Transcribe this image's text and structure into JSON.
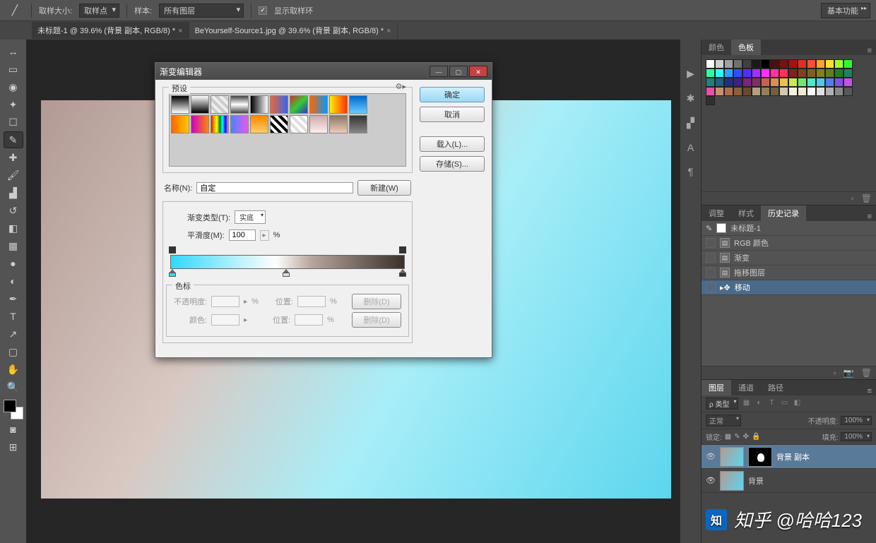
{
  "options": {
    "sample_size_label": "取样大小:",
    "sample_size_value": "取样点",
    "sample_label": "样本:",
    "sample_value": "所有图层",
    "show_ring_label": "显示取样环",
    "workspace": "基本功能"
  },
  "tabs": [
    {
      "label": "未标题-1 @ 39.6% (背景 副本, RGB/8) *",
      "active": true
    },
    {
      "label": "BeYourself-Source1.jpg @ 39.6% (背景 副本, RGB/8) *",
      "active": false
    }
  ],
  "panels": {
    "color_tabs": [
      "颜色",
      "色板"
    ],
    "color_active_idx": 1,
    "history_tabs": [
      "调整",
      "样式",
      "历史记录"
    ],
    "history_active_idx": 2,
    "history_doc": "未标题-1",
    "history": [
      {
        "label": "RGB 颜色"
      },
      {
        "label": "渐变"
      },
      {
        "label": "拖移图层"
      },
      {
        "label": "移动"
      }
    ],
    "layers_tabs": [
      "图层",
      "通道",
      "路径"
    ],
    "layers_active_idx": 0,
    "layer_kind": "ρ 类型",
    "blend_mode": "正常",
    "opacity_label": "不透明度:",
    "opacity_value": "100%",
    "lock_label": "锁定:",
    "fill_label": "填充:",
    "fill_value": "100%",
    "layer1": "背景 副本",
    "layer2": "背景"
  },
  "dialog": {
    "title": "渐变编辑器",
    "presets_label": "预设",
    "ok": "确定",
    "cancel": "取消",
    "load": "载入(L)...",
    "save": "存储(S)...",
    "name_label": "名称(N):",
    "name_value": "自定",
    "new_btn": "新建(W)",
    "gradient_type_label": "渐变类型(T):",
    "gradient_type_value": "实底",
    "smoothness_label": "平滑度(M):",
    "smoothness_value": "100",
    "smoothness_unit": "%",
    "stops_label": "色标",
    "row1_l1": "不透明度:",
    "row1_l2": "位置:",
    "row_unit": "%",
    "delete_btn": "删除(D)",
    "row2_l1": "颜色:"
  },
  "swatches": [
    "#ffffff",
    "#d0d0d0",
    "#a0a0a0",
    "#707070",
    "#404040",
    "#1a1a1a",
    "#000000",
    "#4a0f0f",
    "#7a1010",
    "#aa1010",
    "#dd3020",
    "#ff5030",
    "#ffa030",
    "#ffe030",
    "#a0ff30",
    "#30ff30",
    "#30ffa0",
    "#30ffff",
    "#30a0ff",
    "#3050ff",
    "#5030ff",
    "#a030ff",
    "#ff30ff",
    "#ff30a0",
    "#ff3050",
    "#802020",
    "#804020",
    "#806020",
    "#808020",
    "#608020",
    "#208020",
    "#208060",
    "#208080",
    "#206080",
    "#203080",
    "#402080",
    "#802080",
    "#803060",
    "#c86050",
    "#d89050",
    "#e8c050",
    "#c8e850",
    "#70e870",
    "#50e8c8",
    "#50c8e8",
    "#5080e8",
    "#8050e8",
    "#c850e8",
    "#e850a8",
    "#c89070",
    "#a87050",
    "#886040",
    "#684830",
    "#b0a080",
    "#908060",
    "#706040",
    "#d0c8b0",
    "#f8f0e0",
    "#f0e8d0",
    "#fcfcfc",
    "#e0e0e0",
    "#b0b0b0",
    "#888888",
    "#585858",
    "#303030"
  ],
  "presets": [
    "linear-gradient(#000,#fff)",
    "linear-gradient(#fff,#000)",
    "repeating-linear-gradient(45deg,#eee 0 4px,#ccc 4px 8px)",
    "linear-gradient(#444,#fff,#444)",
    "linear-gradient(90deg,#000,#fff)",
    "linear-gradient(90deg,#e63,#36e)",
    "linear-gradient(135deg,#c33,#3c3,#33c)",
    "linear-gradient(90deg,#f60,#09f)",
    "linear-gradient(90deg,#fe0,#f30)",
    "linear-gradient(#06c,#6cf)",
    "linear-gradient(90deg,#f60,#fc0)",
    "linear-gradient(90deg,#c0c,#f80)",
    "linear-gradient(90deg,red,orange,yellow,green,cyan,blue,violet)",
    "linear-gradient(90deg,#48f,#e5e)",
    "linear-gradient(#f80,#fc6)",
    "repeating-linear-gradient(45deg,#000 0 4px,#fff 4px 8px)",
    "repeating-linear-gradient(45deg,#ddd 0 4px,#fff 4px 8px)",
    "linear-gradient(#caa,#fee)",
    "linear-gradient(#876,#ecb)",
    "linear-gradient(#333,#888)"
  ],
  "watermark": "知乎 @哈哈123"
}
